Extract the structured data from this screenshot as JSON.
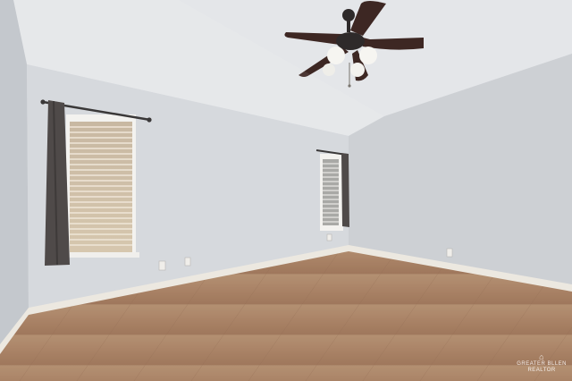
{
  "scene": {
    "description_type": "empty-room-photo",
    "colors": {
      "wall_left": "#c4c8cd",
      "wall_back": "#d6d9dd",
      "wall_right": "#cdd0d4",
      "ceiling": "#e4e6e9",
      "floor": "#a87e5e",
      "baseboard": "#ece8e0",
      "curtain": "#4f4a49",
      "fan_blade": "#3d2723"
    },
    "icons": [
      "ceiling-fan-icon",
      "brokerage-logo-icon"
    ]
  },
  "watermark": {
    "line1": "GREATER BLLEN",
    "line2": "REALTOR"
  }
}
